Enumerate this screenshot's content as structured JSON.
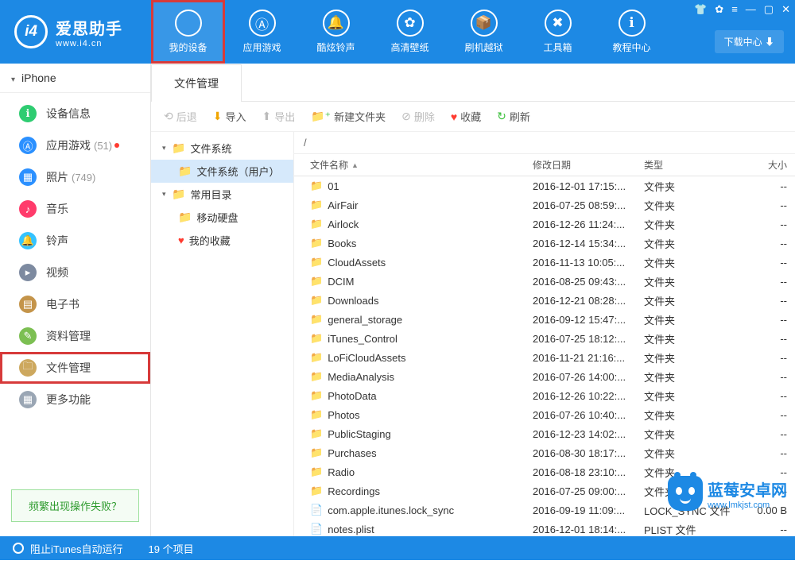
{
  "app": {
    "name": "爱思助手",
    "url": "www.i4.cn"
  },
  "nav": [
    {
      "label": "我的设备",
      "icon": "apple-icon",
      "glyph": ""
    },
    {
      "label": "应用游戏",
      "icon": "appstore-icon",
      "glyph": "Ⓐ"
    },
    {
      "label": "酷炫铃声",
      "icon": "bell-icon",
      "glyph": "🔔"
    },
    {
      "label": "高清壁纸",
      "icon": "flower-icon",
      "glyph": "✿"
    },
    {
      "label": "刷机越狱",
      "icon": "box-icon",
      "glyph": "📦"
    },
    {
      "label": "工具箱",
      "icon": "tools-icon",
      "glyph": "✖"
    },
    {
      "label": "教程中心",
      "icon": "info-icon",
      "glyph": "ℹ"
    }
  ],
  "download_center": "下载中心 ⬇",
  "device": "iPhone",
  "sidebar": [
    {
      "label": "设备信息",
      "color": "#2ecc71",
      "glyph": "ℹ"
    },
    {
      "label": "应用游戏",
      "color": "#2b90ff",
      "glyph": "Ⓐ",
      "count": "(51)",
      "dot": true
    },
    {
      "label": "照片",
      "color": "#2b90ff",
      "glyph": "▦",
      "count": "(749)"
    },
    {
      "label": "音乐",
      "color": "#ff3b6b",
      "glyph": "♪"
    },
    {
      "label": "铃声",
      "color": "#35c3ff",
      "glyph": "🔔"
    },
    {
      "label": "视频",
      "color": "#7d8aa0",
      "glyph": "▸"
    },
    {
      "label": "电子书",
      "color": "#c4944a",
      "glyph": "▤"
    },
    {
      "label": "资料管理",
      "color": "#7cbf52",
      "glyph": "✎"
    },
    {
      "label": "文件管理",
      "color": "#cda85e",
      "glyph": "🗀",
      "selected": true
    },
    {
      "label": "更多功能",
      "color": "#9aa6b4",
      "glyph": "▦"
    }
  ],
  "help": "频繁出现操作失败？",
  "tab": "文件管理",
  "tools": {
    "back": "后退",
    "import": "导入",
    "export": "导出",
    "newfolder": "新建文件夹",
    "delete": "删除",
    "favorite": "收藏",
    "refresh": "刷新"
  },
  "tree": {
    "fs": "文件系统",
    "fs_user": "文件系统（用户）",
    "common": "常用目录",
    "drive": "移动硬盘",
    "fav": "我的收藏"
  },
  "path": "/",
  "columns": {
    "name": "文件名称",
    "date": "修改日期",
    "type": "类型",
    "size": "大小"
  },
  "files": [
    {
      "name": "01",
      "date": "2016-12-01 17:15:...",
      "type": "文件夹",
      "size": "--",
      "kind": "folder"
    },
    {
      "name": "AirFair",
      "date": "2016-07-25 08:59:...",
      "type": "文件夹",
      "size": "--",
      "kind": "folder"
    },
    {
      "name": "Airlock",
      "date": "2016-12-26 11:24:...",
      "type": "文件夹",
      "size": "--",
      "kind": "folder"
    },
    {
      "name": "Books",
      "date": "2016-12-14 15:34:...",
      "type": "文件夹",
      "size": "--",
      "kind": "folder"
    },
    {
      "name": "CloudAssets",
      "date": "2016-11-13 10:05:...",
      "type": "文件夹",
      "size": "--",
      "kind": "folder"
    },
    {
      "name": "DCIM",
      "date": "2016-08-25 09:43:...",
      "type": "文件夹",
      "size": "--",
      "kind": "folder"
    },
    {
      "name": "Downloads",
      "date": "2016-12-21 08:28:...",
      "type": "文件夹",
      "size": "--",
      "kind": "folder"
    },
    {
      "name": "general_storage",
      "date": "2016-09-12 15:47:...",
      "type": "文件夹",
      "size": "--",
      "kind": "folder"
    },
    {
      "name": "iTunes_Control",
      "date": "2016-07-25 18:12:...",
      "type": "文件夹",
      "size": "--",
      "kind": "folder"
    },
    {
      "name": "LoFiCloudAssets",
      "date": "2016-11-21 21:16:...",
      "type": "文件夹",
      "size": "--",
      "kind": "folder"
    },
    {
      "name": "MediaAnalysis",
      "date": "2016-07-26 14:00:...",
      "type": "文件夹",
      "size": "--",
      "kind": "folder"
    },
    {
      "name": "PhotoData",
      "date": "2016-12-26 10:22:...",
      "type": "文件夹",
      "size": "--",
      "kind": "folder"
    },
    {
      "name": "Photos",
      "date": "2016-07-26 10:40:...",
      "type": "文件夹",
      "size": "--",
      "kind": "folder"
    },
    {
      "name": "PublicStaging",
      "date": "2016-12-23 14:02:...",
      "type": "文件夹",
      "size": "--",
      "kind": "folder"
    },
    {
      "name": "Purchases",
      "date": "2016-08-30 18:17:...",
      "type": "文件夹",
      "size": "--",
      "kind": "folder"
    },
    {
      "name": "Radio",
      "date": "2016-08-18 23:10:...",
      "type": "文件夹",
      "size": "--",
      "kind": "folder"
    },
    {
      "name": "Recordings",
      "date": "2016-07-25 09:00:...",
      "type": "文件夹",
      "size": "--",
      "kind": "folder"
    },
    {
      "name": "com.apple.itunes.lock_sync",
      "date": "2016-09-19 11:09:...",
      "type": "LOCK_SYNC 文件",
      "size": "0.00 B",
      "kind": "file"
    },
    {
      "name": "notes.plist",
      "date": "2016-12-01 18:14:...",
      "type": "PLIST 文件",
      "size": "--",
      "kind": "file"
    }
  ],
  "status": {
    "itunes": "阻止iTunes自动运行",
    "count": "19 个项目"
  },
  "watermark": {
    "name": "蓝莓安卓网",
    "url": "www.lmkjst.com"
  }
}
